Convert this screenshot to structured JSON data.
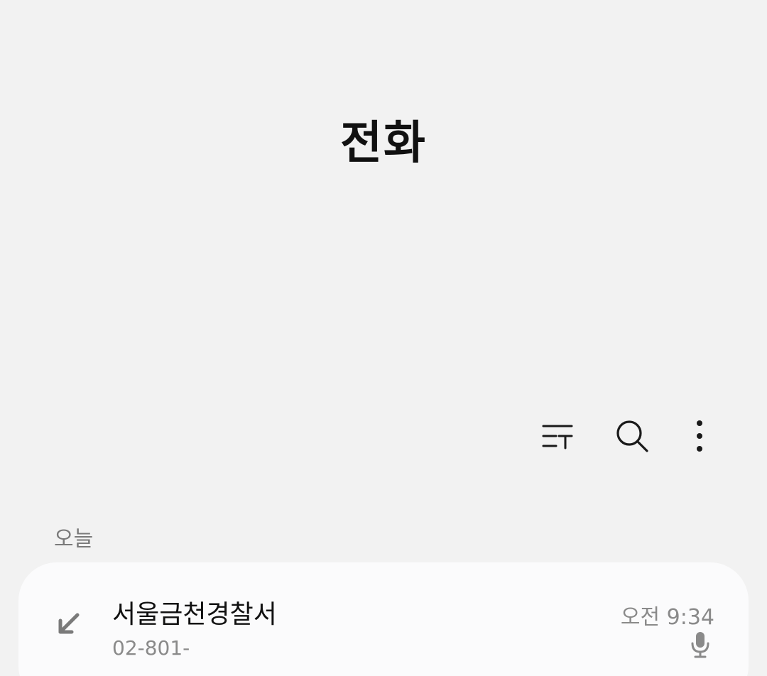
{
  "header": {
    "title": "전화"
  },
  "toolbar": {
    "filter_icon": "filter-list-icon",
    "search_icon": "search-icon",
    "more_icon": "more-vertical-icon"
  },
  "call_log": {
    "section_label": "오늘",
    "entries": [
      {
        "name": "서울금천경찰서",
        "number": "02-801-",
        "time": "오전 9:34",
        "call_type_icon": "incoming-call-arrow-icon",
        "recording_icon": "microphone-icon"
      }
    ]
  },
  "colors": {
    "background": "#f2f2f2",
    "card": "#fbfbfc",
    "primary_text": "#111111",
    "secondary_text": "#8a8a8a"
  }
}
